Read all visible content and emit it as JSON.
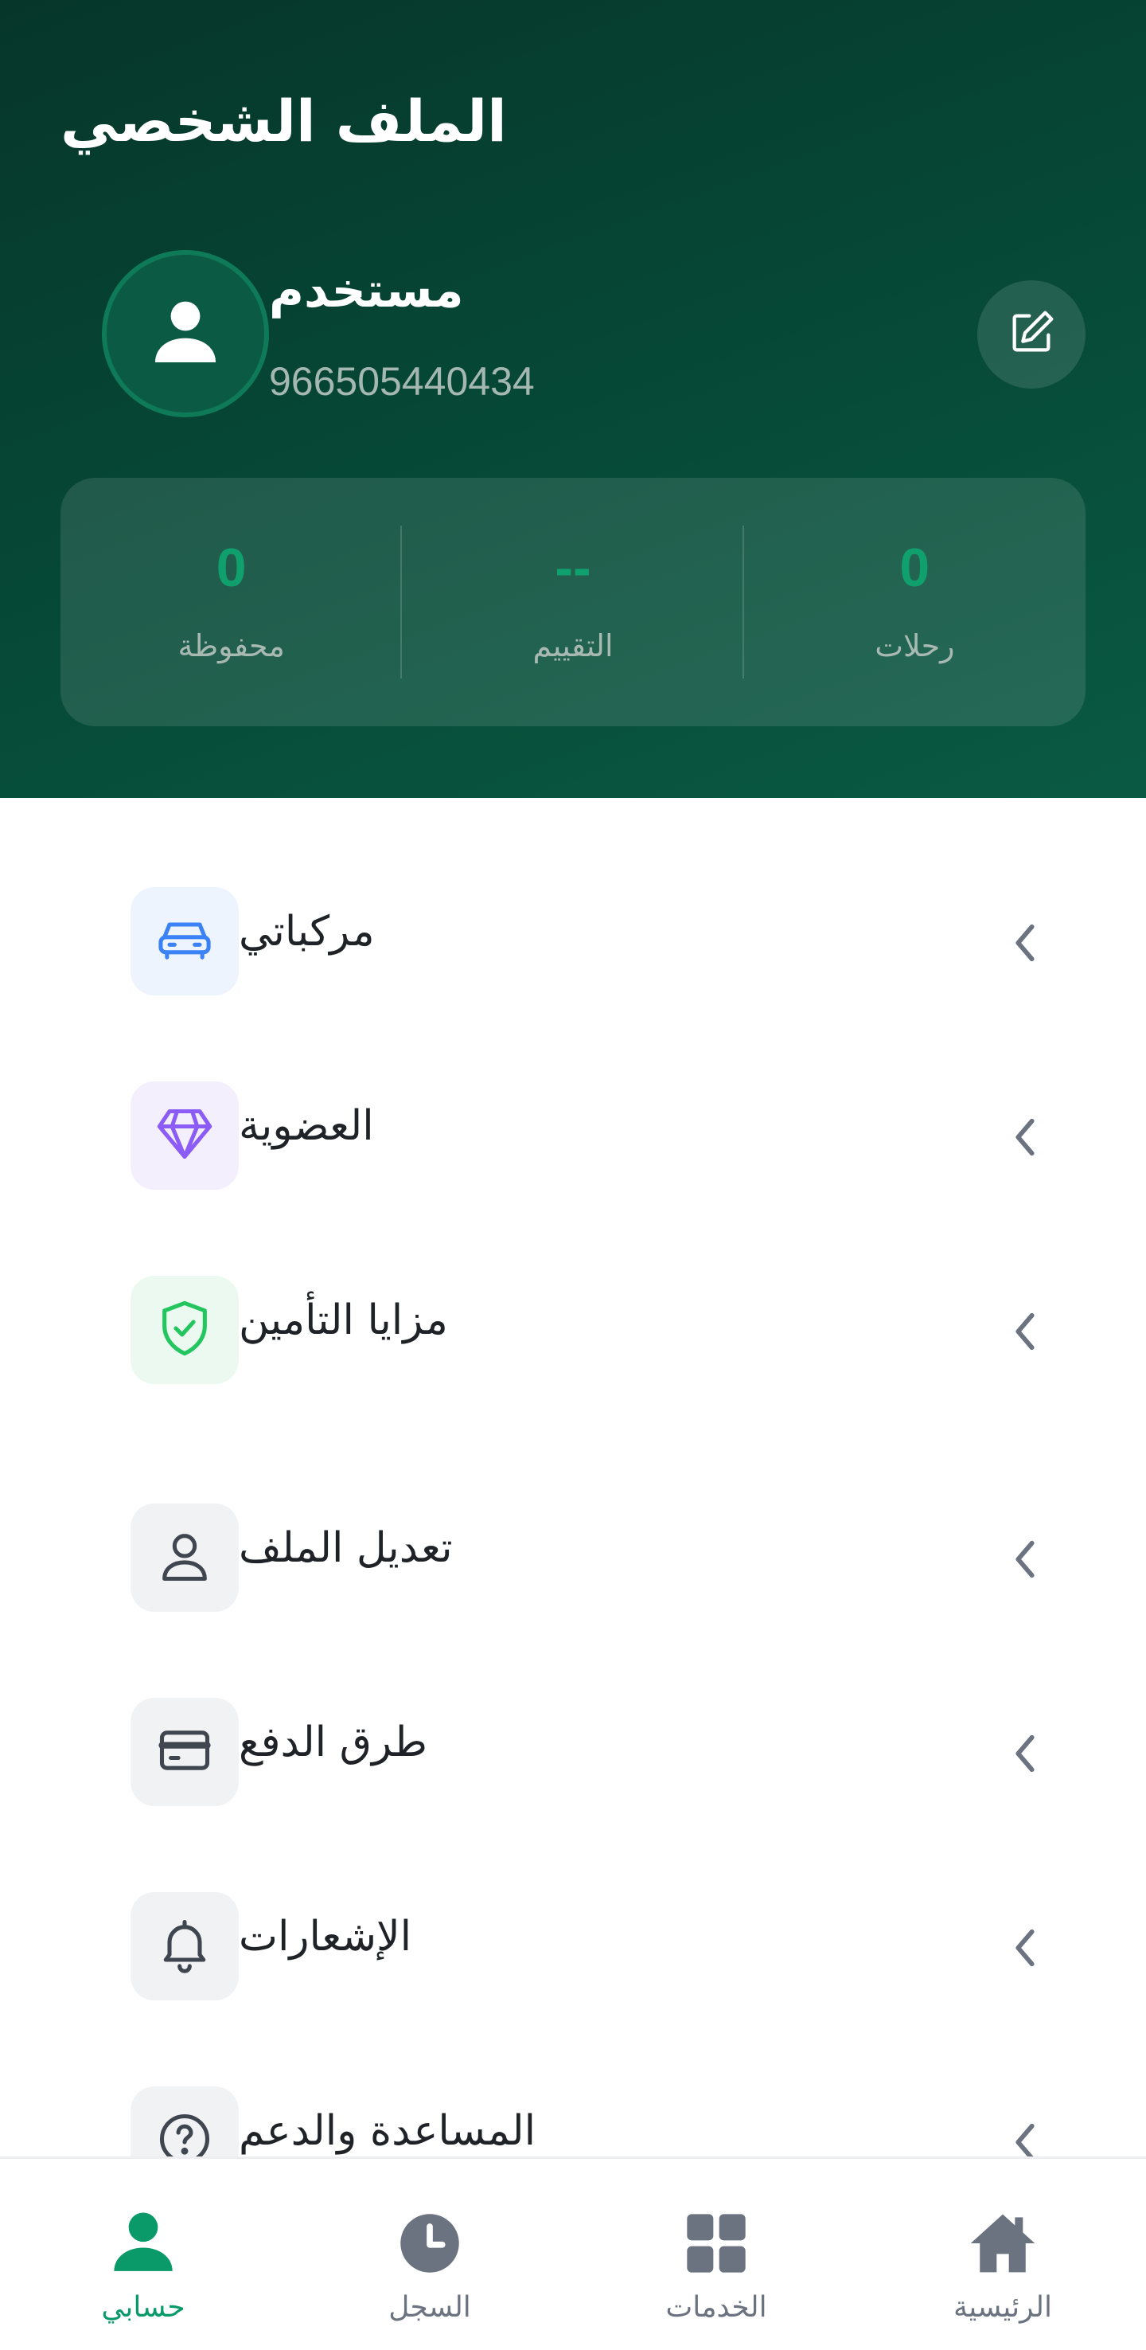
{
  "header": {
    "title": "الملف الشخصي",
    "user_name": "مستخدم",
    "user_phone": "966505440434",
    "edit_icon": "edit-icon",
    "avatar_icon": "user-icon"
  },
  "stats": [
    {
      "value": "0",
      "label": "رحلات"
    },
    {
      "value": "--",
      "label": "التقييم"
    },
    {
      "value": "0",
      "label": "محفوظة"
    }
  ],
  "menu": {
    "items": [
      {
        "label": "مركباتي",
        "icon": "car-icon",
        "icon_bg": "#eef4fe",
        "icon_color": "#3b82f6"
      },
      {
        "label": "العضوية",
        "icon": "diamond-icon",
        "icon_bg": "#f3effd",
        "icon_color": "#8b5cf6"
      },
      {
        "label": "مزايا التأمين",
        "icon": "shield-check-icon",
        "icon_bg": "#ecf9f0",
        "icon_color": "#22c55e"
      },
      {
        "label": "تعديل الملف",
        "icon": "user-outline-icon",
        "icon_bg": "#f1f2f4",
        "icon_color": "#3f4650"
      },
      {
        "label": "طرق الدفع",
        "icon": "credit-card-icon",
        "icon_bg": "#f1f2f4",
        "icon_color": "#3f4650"
      },
      {
        "label": "الإشعارات",
        "icon": "bell-icon",
        "icon_bg": "#f1f2f4",
        "icon_color": "#3f4650"
      },
      {
        "label": "المساعدة والدعم",
        "icon": "help-circle-icon",
        "icon_bg": "#f1f2f4",
        "icon_color": "#3f4650"
      }
    ]
  },
  "bottom_nav": {
    "items": [
      {
        "label": "الرئيسية",
        "icon": "home-icon"
      },
      {
        "label": "الخدمات",
        "icon": "grid-icon"
      },
      {
        "label": "السجل",
        "icon": "clock-icon"
      },
      {
        "label": "حسابي",
        "icon": "user-icon",
        "active": true
      }
    ]
  },
  "colors": {
    "accent": "#0a9a6a",
    "header_dark": "#06362a",
    "chevron": "#6b7280"
  }
}
